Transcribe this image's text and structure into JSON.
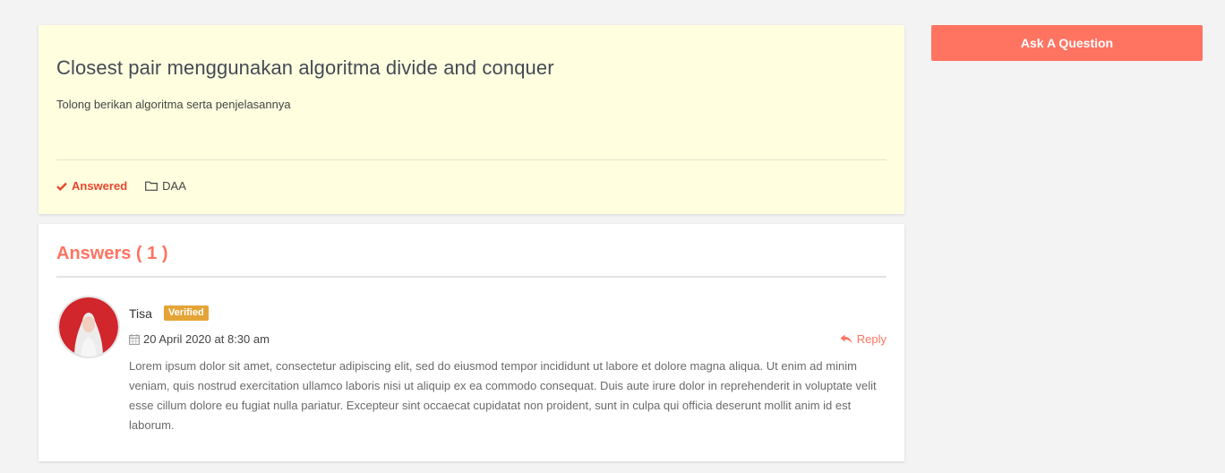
{
  "question": {
    "title": "Closest pair menggunakan algoritma divide and conquer",
    "body": "Tolong berikan algoritma serta penjelasannya",
    "status_label": "Answered",
    "category": "DAA"
  },
  "sidebar": {
    "ask_button_label": "Ask A Question"
  },
  "answers": {
    "heading": "Answers ( 1 )",
    "items": [
      {
        "author": "Tisa",
        "badge": "Verified",
        "date": "20 April 2020 at 8:30 am",
        "reply_label": "Reply",
        "text": "Lorem ipsum dolor sit amet, consectetur adipiscing elit, sed do eiusmod tempor incididunt ut labore et dolore magna aliqua. Ut enim ad minim veniam, quis nostrud exercitation ullamco laboris nisi ut aliquip ex ea commodo consequat. Duis aute irure dolor in reprehenderit in voluptate velit esse cillum dolore eu fugiat nulla pariatur. Excepteur sint occaecat cupidatat non proident, sunt in culpa qui officia deserunt mollit anim id est laborum."
      }
    ]
  },
  "icons": {
    "status": "check-icon",
    "category": "folder-icon",
    "date": "calendar-icon",
    "reply": "reply-icon"
  },
  "colors": {
    "accent": "#ff7361",
    "answered": "#e8452c",
    "verified": "#e4a437",
    "question_bg": "#ffffe0"
  }
}
